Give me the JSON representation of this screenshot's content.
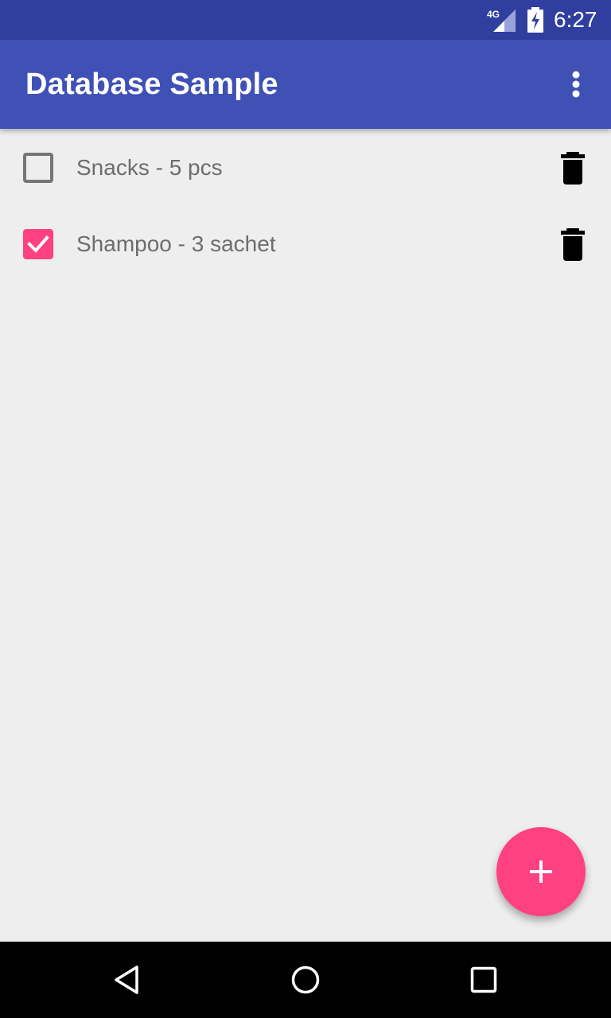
{
  "status_bar": {
    "network_label": "4G",
    "time": "6:27",
    "icons": [
      "network-4g-icon",
      "battery-charging-icon"
    ]
  },
  "app_bar": {
    "title": "Database Sample",
    "overflow_icon": "more-vert-icon",
    "color": "#3f51b5"
  },
  "items": [
    {
      "label": "Snacks - 5 pcs",
      "checked": false,
      "delete_icon": "trash-icon"
    },
    {
      "label": "Shampoo - 3 sachet",
      "checked": true,
      "delete_icon": "trash-icon"
    }
  ],
  "fab": {
    "icon": "plus-icon",
    "color": "#ff4081"
  },
  "nav_bar": {
    "buttons": [
      "back-icon",
      "home-icon",
      "recents-icon"
    ]
  },
  "colors": {
    "status_bar": "#303f9f",
    "primary": "#3f51b5",
    "accent": "#ff4081",
    "background": "#eeeeee"
  }
}
